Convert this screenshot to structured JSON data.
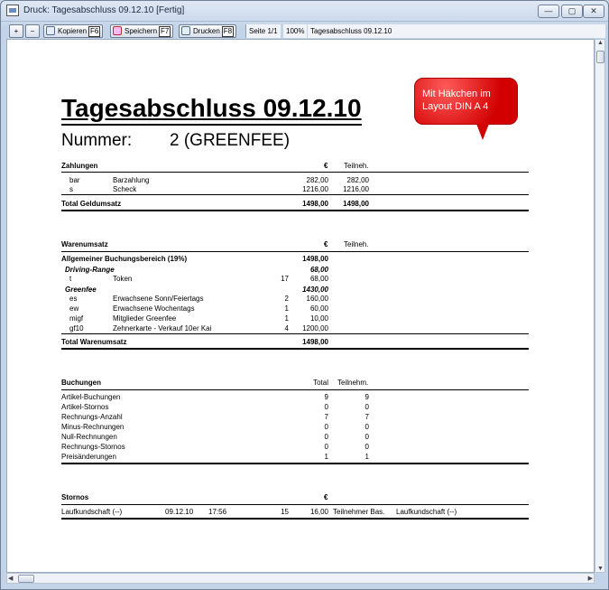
{
  "window": {
    "title": "Druck: Tagesabschluss 09.12.10 [Fertig]",
    "minimize": "—",
    "maximize": "▢",
    "close": "✕"
  },
  "toolbar": {
    "zoom_in": "+",
    "zoom_out": "−",
    "copy_label": "Kopieren",
    "copy_key": "F6",
    "save_label": "Speichern",
    "save_key": "F7",
    "print_label": "Drucken",
    "print_key": "F8",
    "page": "Seite 1/1",
    "zoom": "100%",
    "doc_name": "Tagesabschluss 09.12.10"
  },
  "callout": {
    "line1": "Mit Häkchen im",
    "line2": "Layout DIN A 4"
  },
  "doc": {
    "title": "Tagesabschluss 09.12.10",
    "number_label": "Nummer:",
    "number_value": "2  (GREENFEE)"
  },
  "zahlungen": {
    "header": "Zahlungen",
    "col_eur": "€",
    "col_teil": "Teilneh.",
    "rows": [
      {
        "code": "bar",
        "desc": "Barzahlung",
        "eur": "282,00",
        "teil": "282,00"
      },
      {
        "code": "s",
        "desc": "Scheck",
        "eur": "1216,00",
        "teil": "1216,00"
      }
    ],
    "total_label": "Total Geldumsatz",
    "total_eur": "1498,00",
    "total_teil": "1498,00"
  },
  "warenumsatz": {
    "header": "Warenumsatz",
    "col_eur": "€",
    "col_teil": "Teilneh.",
    "group_label": "Allgemeiner Buchungsbereich (19%)",
    "group_eur": "1498,00",
    "sub1_label": "Driving-Range",
    "sub1_eur": "68,00",
    "sub1_rows": [
      {
        "code": "t",
        "desc": "Token",
        "qty": "17",
        "eur": "68,00"
      }
    ],
    "sub2_label": "Greenfee",
    "sub2_eur": "1430,00",
    "sub2_rows": [
      {
        "code": "es",
        "desc": "Erwachsene Sonn/Feiertags",
        "qty": "2",
        "eur": "160,00"
      },
      {
        "code": "ew",
        "desc": "Erwachsene Wochentags",
        "qty": "1",
        "eur": "60,00"
      },
      {
        "code": "migf",
        "desc": "Mitglieder Greenfee",
        "qty": "1",
        "eur": "10,00"
      },
      {
        "code": "gf10",
        "desc": "Zehnerkarte - Verkauf 10er Kai",
        "qty": "4",
        "eur": "1200,00"
      }
    ],
    "total_label": "Total Warenumsatz",
    "total_eur": "1498,00"
  },
  "buchungen": {
    "header": "Buchungen",
    "col_total": "Total",
    "col_teil": "Teilnehm.",
    "rows": [
      {
        "label": "Artikel-Buchungen",
        "total": "9",
        "teil": "9"
      },
      {
        "label": "Artikel-Stornos",
        "total": "0",
        "teil": "0"
      },
      {
        "label": "Rechnungs-Anzahl",
        "total": "7",
        "teil": "7"
      },
      {
        "label": "Minus-Rechnungen",
        "total": "0",
        "teil": "0"
      },
      {
        "label": "Null-Rechnungen",
        "total": "0",
        "teil": "0"
      },
      {
        "label": "Rechnungs-Stornos",
        "total": "0",
        "teil": "0"
      },
      {
        "label": "Preisänderungen",
        "total": "1",
        "teil": "1"
      }
    ]
  },
  "stornos": {
    "header": "Stornos",
    "col_eur": "€",
    "row": {
      "name": "Laufkundschaft (--)",
      "date": "09.12.10",
      "time": "17:56",
      "qty": "15",
      "eur": "16,00",
      "type": "Teilnehmer Bas.",
      "who": "Laufkundschaft (--)"
    }
  }
}
